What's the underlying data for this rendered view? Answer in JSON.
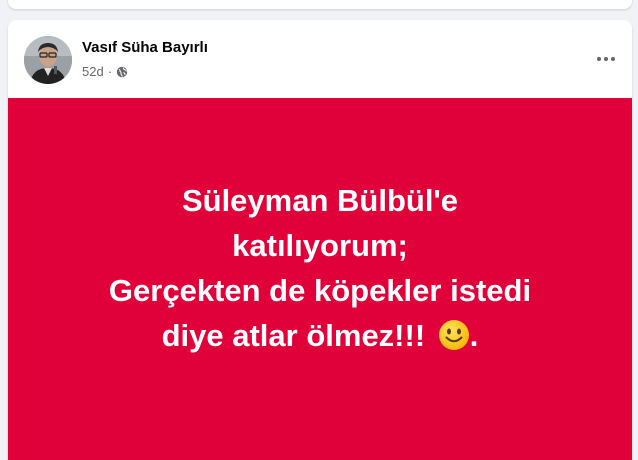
{
  "post": {
    "author": "Vasıf Süha Bayırlı",
    "time": "52d",
    "separator": "·",
    "privacy_icon": "globe-icon",
    "more_icon": "more-horizontal-icon",
    "background_color": "#e0003a",
    "text_lines": [
      "Süleyman Bülbül'e",
      "katılıyorum;",
      "Gerçekten de köpekler istedi",
      "diye atlar ölmez!!!"
    ],
    "emoji": "slightly-smiling-face-icon",
    "trailing": "."
  }
}
